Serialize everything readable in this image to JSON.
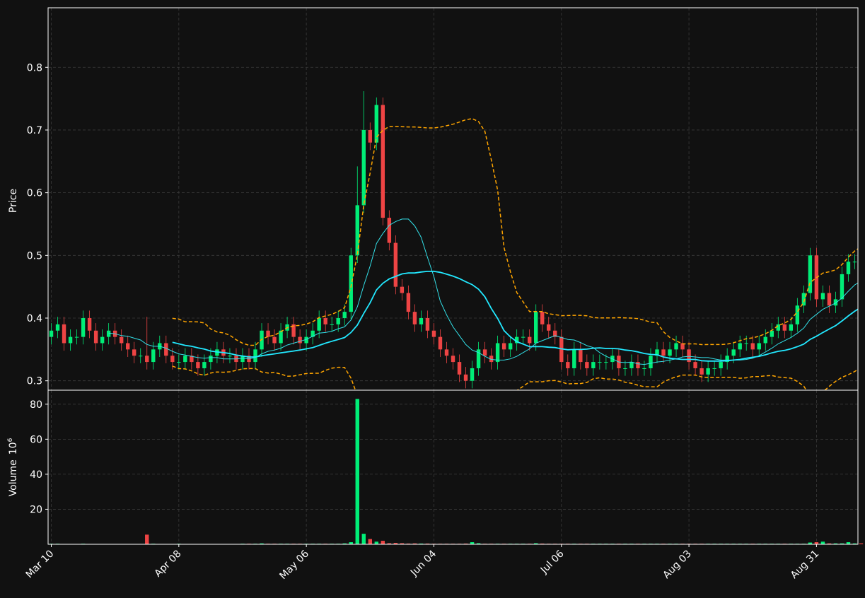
{
  "colors": {
    "background": "#111111",
    "up": "#00ee77",
    "down": "#ee4444",
    "sma_fast": "#33e0e8",
    "sma_slow": "#22e8ff",
    "bollinger": "#ffa500",
    "grid": "#3a3a3a"
  },
  "chart_data": {
    "type": "candlestick",
    "grid": true,
    "price_panel": {
      "ylabel": "Price",
      "ylim": [
        0.285,
        0.895
      ],
      "yticks": [
        0.3,
        0.4,
        0.5,
        0.6,
        0.7,
        0.8
      ],
      "ytick_labels": [
        "0.3",
        "0.4",
        "0.5",
        "0.6",
        "0.7",
        "0.8"
      ]
    },
    "volume_panel": {
      "ylabel": "Volume",
      "ylabel_exponent": "10^6",
      "ylabel_base": "10",
      "ylabel_power": "6",
      "ylim": [
        0,
        88
      ],
      "yticks": [
        20,
        40,
        60,
        80
      ],
      "ytick_labels": [
        "20",
        "40",
        "60",
        "80"
      ]
    },
    "x_axis": {
      "date_range": [
        "Mar 10",
        "Sep 06"
      ],
      "tick_positions": [
        0,
        20,
        40,
        60,
        80,
        100,
        120
      ],
      "tick_labels": [
        "Mar 10",
        "Apr 08",
        "May 06",
        "Jun 04",
        "Jul 06",
        "Aug 03",
        "Aug 31"
      ],
      "xlim": [
        -0.5,
        126.5
      ]
    },
    "closes": [
      0.38,
      0.39,
      0.36,
      0.37,
      0.37,
      0.4,
      0.38,
      0.36,
      0.37,
      0.38,
      0.37,
      0.36,
      0.35,
      0.34,
      0.34,
      0.33,
      0.35,
      0.36,
      0.34,
      0.33,
      0.33,
      0.34,
      0.33,
      0.32,
      0.33,
      0.34,
      0.35,
      0.34,
      0.34,
      0.33,
      0.34,
      0.33,
      0.35,
      0.38,
      0.37,
      0.36,
      0.38,
      0.39,
      0.37,
      0.36,
      0.37,
      0.38,
      0.4,
      0.39,
      0.39,
      0.4,
      0.41,
      0.5,
      0.58,
      0.7,
      0.68,
      0.74,
      0.56,
      0.52,
      0.45,
      0.44,
      0.41,
      0.39,
      0.4,
      0.38,
      0.37,
      0.35,
      0.34,
      0.33,
      0.31,
      0.3,
      0.32,
      0.35,
      0.34,
      0.33,
      0.36,
      0.35,
      0.36,
      0.37,
      0.37,
      0.36,
      0.41,
      0.39,
      0.38,
      0.37,
      0.33,
      0.32,
      0.35,
      0.33,
      0.32,
      0.33,
      0.33,
      0.33,
      0.34,
      0.32,
      0.32,
      0.33,
      0.32,
      0.32,
      0.34,
      0.35,
      0.34,
      0.35,
      0.36,
      0.35,
      0.33,
      0.32,
      0.31,
      0.32,
      0.32,
      0.33,
      0.34,
      0.35,
      0.36,
      0.36,
      0.35,
      0.36,
      0.37,
      0.38,
      0.39,
      0.38,
      0.39,
      0.42,
      0.44,
      0.5,
      0.43,
      0.44,
      0.42,
      0.43,
      0.47,
      0.49,
      0.49,
      0.48,
      0.5,
      0.47
    ],
    "volume_millions": [
      0.3,
      0.3,
      0.2,
      0.2,
      0.2,
      0.3,
      0.2,
      0.2,
      0.2,
      0.2,
      0.2,
      0.2,
      0.2,
      0.2,
      0.2,
      5.5,
      0.3,
      0.2,
      0.2,
      0.2,
      0.3,
      0.2,
      0.2,
      0.2,
      0.2,
      0.2,
      0.2,
      0.2,
      0.2,
      0.2,
      0.3,
      0.3,
      0.3,
      0.5,
      0.3,
      0.3,
      0.3,
      0.3,
      0.3,
      0.3,
      0.3,
      0.3,
      0.3,
      0.3,
      0.3,
      0.3,
      0.5,
      1.2,
      83,
      6,
      3,
      1.5,
      2,
      0.6,
      0.8,
      0.6,
      0.4,
      0.5,
      0.4,
      0.4,
      0.3,
      0.3,
      0.3,
      0.3,
      0.3,
      0.4,
      1.2,
      0.6,
      0.3,
      0.3,
      0.3,
      0.3,
      0.3,
      0.3,
      0.3,
      0.3,
      0.6,
      0.4,
      0.3,
      0.3,
      0.3,
      0.3,
      0.3,
      0.3,
      0.3,
      0.3,
      0.3,
      0.3,
      0.3,
      0.3,
      0.3,
      0.3,
      0.3,
      0.3,
      0.3,
      0.3,
      0.3,
      0.3,
      0.3,
      0.3,
      0.3,
      0.3,
      0.3,
      0.3,
      0.3,
      0.3,
      0.3,
      0.3,
      0.3,
      0.3,
      0.3,
      0.3,
      0.3,
      0.3,
      0.3,
      0.3,
      0.3,
      0.3,
      0.3,
      1,
      1.2,
      1.5,
      0.5,
      0.5,
      0.5,
      1.2,
      0.5,
      0.5,
      0.6,
      0.5
    ]
  }
}
